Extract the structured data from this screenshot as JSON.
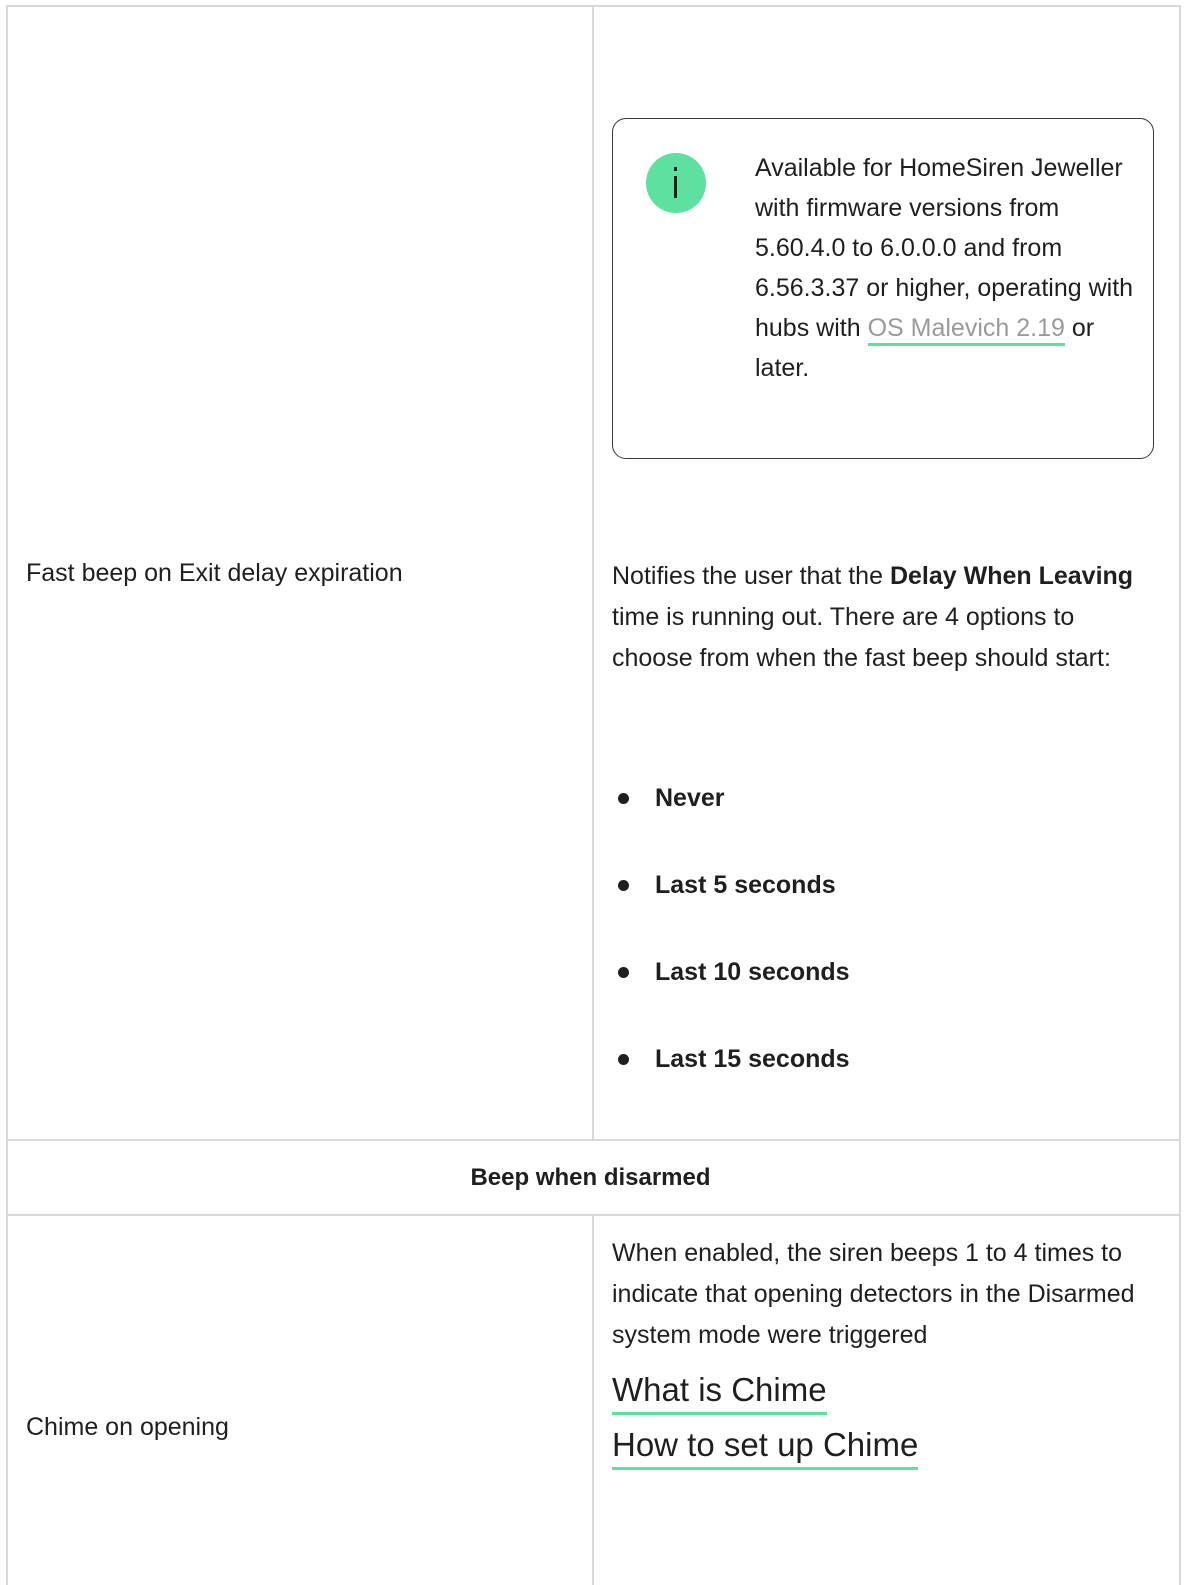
{
  "note": {
    "text_before_link": "Available for HomeSiren Jeweller with firmware versions from 5.60.4.0 to 6.0.0.0 and from 6.56.3.37 or higher, operating with hubs with ",
    "link_label": "OS Malevich 2.19",
    "text_after_link": " or later.",
    "icon": "info-icon",
    "icon_color": "#5ee0a0"
  },
  "rows": {
    "fast_beep": {
      "label": "Fast beep on Exit delay expiration",
      "desc_part1": "Notifies the user that the ",
      "desc_bold": "Delay When Leaving",
      "desc_part2": " time is running out. There are 4 options to choose from when the fast beep should start:",
      "options": [
        "Never",
        "Last 5 seconds",
        "Last 10 seconds",
        "Last 15 seconds"
      ]
    },
    "section_title": "Beep when disarmed",
    "chime": {
      "label": "Chime on opening",
      "description": "When enabled, the siren beeps 1 to 4 times to indicate that opening detectors in the Disarmed system mode were triggered",
      "link1": "What is Chime",
      "link2": "How to set up Chime"
    }
  },
  "colors": {
    "accent": "#5ee0a0",
    "border": "#d9d9d9",
    "text": "#1f1f1f",
    "muted_link": "#9a9a9a"
  }
}
